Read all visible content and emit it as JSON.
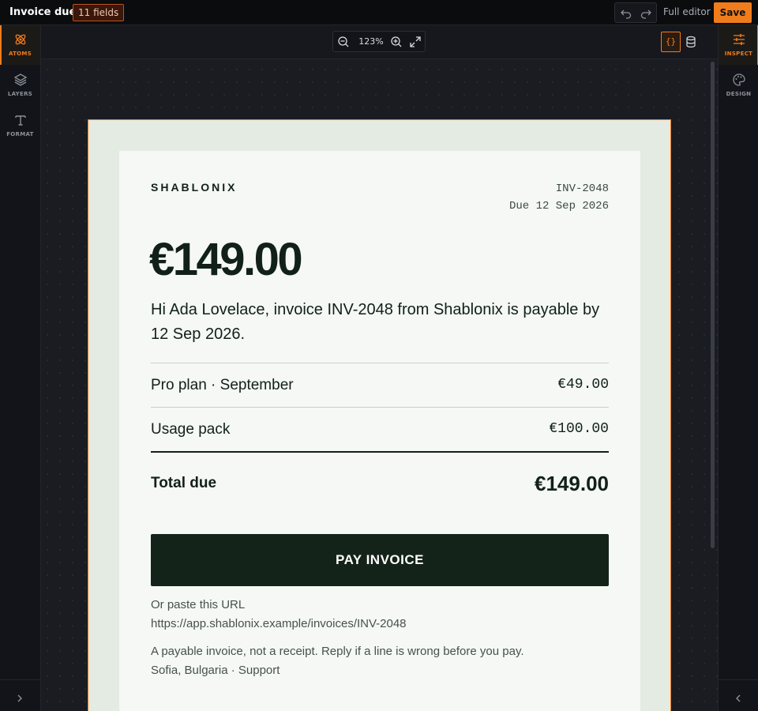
{
  "topbar": {
    "title": "Invoice due",
    "fields_badge": "11 fields",
    "full_editor_label": "Full editor",
    "save_label": "Save"
  },
  "left_rail": {
    "items": [
      {
        "label": "ATOMS",
        "icon": "atom-icon",
        "active": true
      },
      {
        "label": "LAYERS",
        "icon": "layers-icon",
        "active": false
      },
      {
        "label": "FORMAT",
        "icon": "type-icon",
        "active": false
      }
    ]
  },
  "right_rail": {
    "items": [
      {
        "label": "INSPECT",
        "icon": "sliders-icon",
        "active": true
      },
      {
        "label": "DESIGN",
        "icon": "palette-icon",
        "active": false
      }
    ]
  },
  "canvas_toolbar": {
    "zoom_level": "123%",
    "code_toggle": "{}"
  },
  "email": {
    "brand": "SHABLONIX",
    "invoice_number": "INV-2048",
    "due_line": "Due 12 Sep 2026",
    "amount": "€149.00",
    "intro": "Hi Ada Lovelace, invoice INV-2048 from Shablonix is payable by 12 Sep 2026.",
    "line_items": [
      {
        "name": "Pro plan · September",
        "value": "€49.00"
      },
      {
        "name": "Usage pack",
        "value": "€100.00"
      }
    ],
    "total_label": "Total due",
    "total_value": "€149.00",
    "pay_button": "PAY INVOICE",
    "paste_label": "Or paste this URL",
    "paste_url": "https://app.shablonix.example/invoices/INV-2048",
    "footnote": "A payable invoice, not a receipt. Reply if a line is wrong before you pay.",
    "footer": "Sofia, Bulgaria · Support"
  },
  "colors": {
    "accent": "#f07c1c",
    "button_dark": "#14231a",
    "card_bg": "#f5f8f4",
    "frame_bg": "#e4ebe3"
  }
}
